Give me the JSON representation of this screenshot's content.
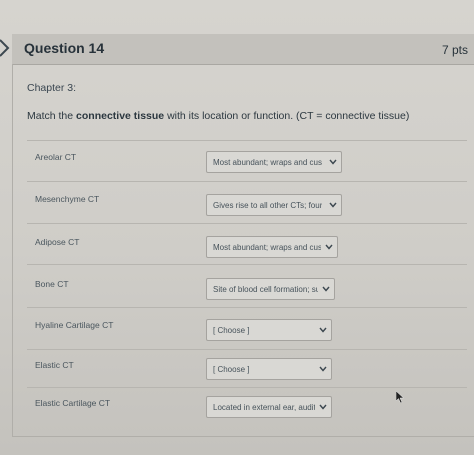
{
  "question": {
    "title": "Question 14",
    "points": "7 pts"
  },
  "chapter": "Chapter 3:",
  "prompt": {
    "before": "Match the ",
    "bold": "connective tissue",
    "after": " with its location or function. (CT = connective tissue)"
  },
  "rows": [
    {
      "label": "Areolar CT",
      "selected": "Most abundant; wraps and cus"
    },
    {
      "label": "Mesenchyme CT",
      "selected": "Gives rise to all other CTs; four"
    },
    {
      "label": "Adipose CT",
      "selected": "Most abundant; wraps and cus"
    },
    {
      "label": "Bone CT",
      "selected": "Site of blood cell formation; su"
    },
    {
      "label": "Hyaline Cartilage CT",
      "selected": "[ Choose ]"
    },
    {
      "label": "Elastic CT",
      "selected": "[ Choose ]"
    },
    {
      "label": "Elastic Cartilage CT",
      "selected": "Located in external ear, audito"
    }
  ],
  "colors": {
    "accent": "#2d3b45",
    "background": "#cfcdc8"
  },
  "icons": {
    "dropdown": "chevron-down-icon",
    "cursor": "mouse-pointer-icon",
    "nav": "back-arrow-icon"
  }
}
